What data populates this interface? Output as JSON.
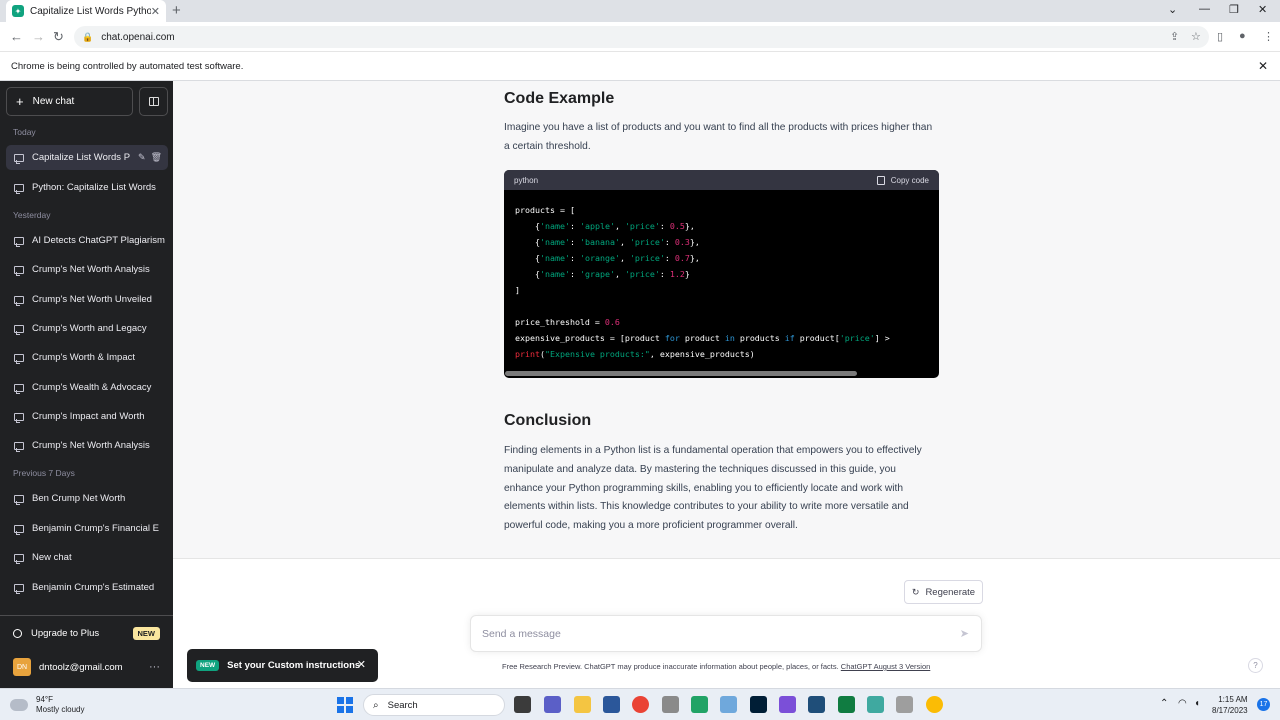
{
  "browser": {
    "tab_title": "Capitalize List Words Python",
    "url": "chat.openai.com",
    "infobar_text": "Chrome is being controlled by automated test software."
  },
  "sidebar": {
    "new_chat_label": "New chat",
    "sections": [
      {
        "heading": "Today",
        "items": [
          "Capitalize List Words P",
          "Python: Capitalize List Words"
        ]
      },
      {
        "heading": "Yesterday",
        "items": [
          "AI Detects ChatGPT Plagiarism",
          "Crump's Net Worth Analysis",
          "Crump's Net Worth Unveiled",
          "Crump's Worth and Legacy",
          "Crump's Worth & Impact",
          "Crump's Wealth & Advocacy",
          "Crump's Impact and Worth",
          "Crump's Net Worth Analysis"
        ]
      },
      {
        "heading": "Previous 7 Days",
        "items": [
          "Ben Crump Net Worth",
          "Benjamin Crump's Financial E",
          "New chat",
          "Benjamin Crump's Estimated"
        ]
      }
    ],
    "upgrade_label": "Upgrade to Plus",
    "upgrade_badge": "NEW",
    "account_email": "dntoolz@gmail.com",
    "avatar_initials": "DN"
  },
  "content": {
    "code_heading": "Code Example",
    "code_intro": "Imagine you have a list of products and you want to find all the products with prices higher than a certain threshold.",
    "code_lang": "python",
    "copy_label": "Copy code",
    "code_lines": [
      [
        {
          "t": "products = ["
        }
      ],
      [
        {
          "t": "    {"
        },
        {
          "t": "'name'",
          "c": "str"
        },
        {
          "t": ": "
        },
        {
          "t": "'apple'",
          "c": "str"
        },
        {
          "t": ", "
        },
        {
          "t": "'price'",
          "c": "str"
        },
        {
          "t": ": "
        },
        {
          "t": "0.5",
          "c": "num"
        },
        {
          "t": "},"
        }
      ],
      [
        {
          "t": "    {"
        },
        {
          "t": "'name'",
          "c": "str"
        },
        {
          "t": ": "
        },
        {
          "t": "'banana'",
          "c": "str"
        },
        {
          "t": ", "
        },
        {
          "t": "'price'",
          "c": "str"
        },
        {
          "t": ": "
        },
        {
          "t": "0.3",
          "c": "num"
        },
        {
          "t": "},"
        }
      ],
      [
        {
          "t": "    {"
        },
        {
          "t": "'name'",
          "c": "str"
        },
        {
          "t": ": "
        },
        {
          "t": "'orange'",
          "c": "str"
        },
        {
          "t": ", "
        },
        {
          "t": "'price'",
          "c": "str"
        },
        {
          "t": ": "
        },
        {
          "t": "0.7",
          "c": "num"
        },
        {
          "t": "},"
        }
      ],
      [
        {
          "t": "    {"
        },
        {
          "t": "'name'",
          "c": "str"
        },
        {
          "t": ": "
        },
        {
          "t": "'grape'",
          "c": "str"
        },
        {
          "t": ", "
        },
        {
          "t": "'price'",
          "c": "str"
        },
        {
          "t": ": "
        },
        {
          "t": "1.2",
          "c": "num"
        },
        {
          "t": "}"
        }
      ],
      [
        {
          "t": "]"
        }
      ],
      [
        {
          "t": ""
        }
      ],
      [
        {
          "t": "price_threshold = "
        },
        {
          "t": "0.6",
          "c": "num"
        }
      ],
      [
        {
          "t": "expensive_products = [product "
        },
        {
          "t": "for",
          "c": "kw"
        },
        {
          "t": " product "
        },
        {
          "t": "in",
          "c": "kw"
        },
        {
          "t": " products "
        },
        {
          "t": "if",
          "c": "kw"
        },
        {
          "t": " product["
        },
        {
          "t": "'price'",
          "c": "str"
        },
        {
          "t": "] >"
        }
      ],
      [
        {
          "t": "print",
          "c": "fn"
        },
        {
          "t": "("
        },
        {
          "t": "\"Expensive products:\"",
          "c": "str"
        },
        {
          "t": ", expensive_products)"
        }
      ]
    ],
    "conclusion_heading": "Conclusion",
    "conclusion_text": "Finding elements in a Python list is a fundamental operation that empowers you to effectively manipulate and analyze data. By mastering the techniques discussed in this guide, you enhance your Python programming skills, enabling you to efficiently locate and work with elements within lists. This knowledge contributes to your ability to write more versatile and powerful code, making you a more proficient programmer overall.",
    "regenerate_label": "Regenerate",
    "composer_placeholder": "Send a message",
    "footer_text": "Free Research Preview. ChatGPT may produce inaccurate information about people, places, or facts. ",
    "footer_link": "ChatGPT August 3 Version",
    "help_label": "?"
  },
  "toast": {
    "badge": "NEW",
    "text": "Set your Custom instructions"
  },
  "taskbar": {
    "weather_temp": "94°F",
    "weather_desc": "Mostly cloudy",
    "search_label": "Search",
    "time": "1:15 AM",
    "date": "8/17/2023",
    "notification_count": "17"
  },
  "colors": {
    "sidebar_bg": "#202123",
    "accent": "#10a37f",
    "code_bg": "#000000"
  }
}
